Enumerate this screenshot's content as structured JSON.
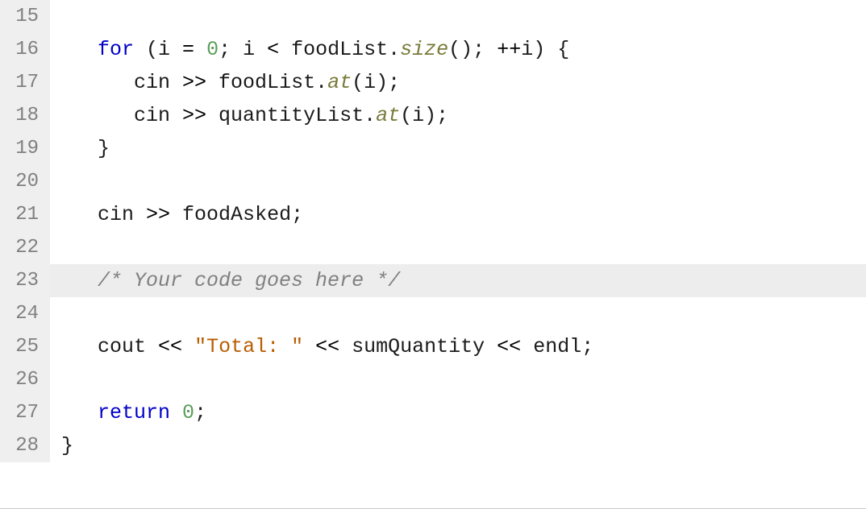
{
  "lines": [
    {
      "number": 15,
      "highlight": false,
      "tokens": []
    },
    {
      "number": 16,
      "highlight": false,
      "tokens": [
        {
          "t": "   ",
          "cls": ""
        },
        {
          "t": "for",
          "cls": "kw"
        },
        {
          "t": " (i ",
          "cls": "id"
        },
        {
          "t": "=",
          "cls": "op"
        },
        {
          "t": " ",
          "cls": ""
        },
        {
          "t": "0",
          "cls": "num"
        },
        {
          "t": "; i ",
          "cls": "id"
        },
        {
          "t": "<",
          "cls": "op"
        },
        {
          "t": " foodList.",
          "cls": "id"
        },
        {
          "t": "size",
          "cls": "fn"
        },
        {
          "t": "(); ",
          "cls": "id"
        },
        {
          "t": "++",
          "cls": "op"
        },
        {
          "t": "i) {",
          "cls": "id"
        }
      ]
    },
    {
      "number": 17,
      "highlight": false,
      "tokens": [
        {
          "t": "      cin ",
          "cls": "id"
        },
        {
          "t": ">>",
          "cls": "op"
        },
        {
          "t": " foodList.",
          "cls": "id"
        },
        {
          "t": "at",
          "cls": "fn"
        },
        {
          "t": "(i);",
          "cls": "id"
        }
      ]
    },
    {
      "number": 18,
      "highlight": false,
      "tokens": [
        {
          "t": "      cin ",
          "cls": "id"
        },
        {
          "t": ">>",
          "cls": "op"
        },
        {
          "t": " quantityList.",
          "cls": "id"
        },
        {
          "t": "at",
          "cls": "fn"
        },
        {
          "t": "(i);",
          "cls": "id"
        }
      ]
    },
    {
      "number": 19,
      "highlight": false,
      "tokens": [
        {
          "t": "   }",
          "cls": "id"
        }
      ]
    },
    {
      "number": 20,
      "highlight": false,
      "tokens": []
    },
    {
      "number": 21,
      "highlight": false,
      "tokens": [
        {
          "t": "   cin ",
          "cls": "id"
        },
        {
          "t": ">>",
          "cls": "op"
        },
        {
          "t": " foodAsked;",
          "cls": "id"
        }
      ]
    },
    {
      "number": 22,
      "highlight": false,
      "tokens": []
    },
    {
      "number": 23,
      "highlight": true,
      "tokens": [
        {
          "t": "   ",
          "cls": ""
        },
        {
          "t": "/* Your code goes here */",
          "cls": "cmt"
        }
      ]
    },
    {
      "number": 24,
      "highlight": false,
      "tokens": []
    },
    {
      "number": 25,
      "highlight": false,
      "tokens": [
        {
          "t": "   cout ",
          "cls": "id"
        },
        {
          "t": "<<",
          "cls": "op"
        },
        {
          "t": " ",
          "cls": ""
        },
        {
          "t": "\"Total: \"",
          "cls": "str"
        },
        {
          "t": " ",
          "cls": ""
        },
        {
          "t": "<<",
          "cls": "op"
        },
        {
          "t": " sumQuantity ",
          "cls": "id"
        },
        {
          "t": "<<",
          "cls": "op"
        },
        {
          "t": " endl;",
          "cls": "id"
        }
      ]
    },
    {
      "number": 26,
      "highlight": false,
      "tokens": []
    },
    {
      "number": 27,
      "highlight": false,
      "tokens": [
        {
          "t": "   ",
          "cls": ""
        },
        {
          "t": "return",
          "cls": "kw"
        },
        {
          "t": " ",
          "cls": ""
        },
        {
          "t": "0",
          "cls": "num"
        },
        {
          "t": ";",
          "cls": "id"
        }
      ]
    },
    {
      "number": 28,
      "highlight": false,
      "tokens": [
        {
          "t": "}",
          "cls": "id"
        }
      ]
    }
  ]
}
